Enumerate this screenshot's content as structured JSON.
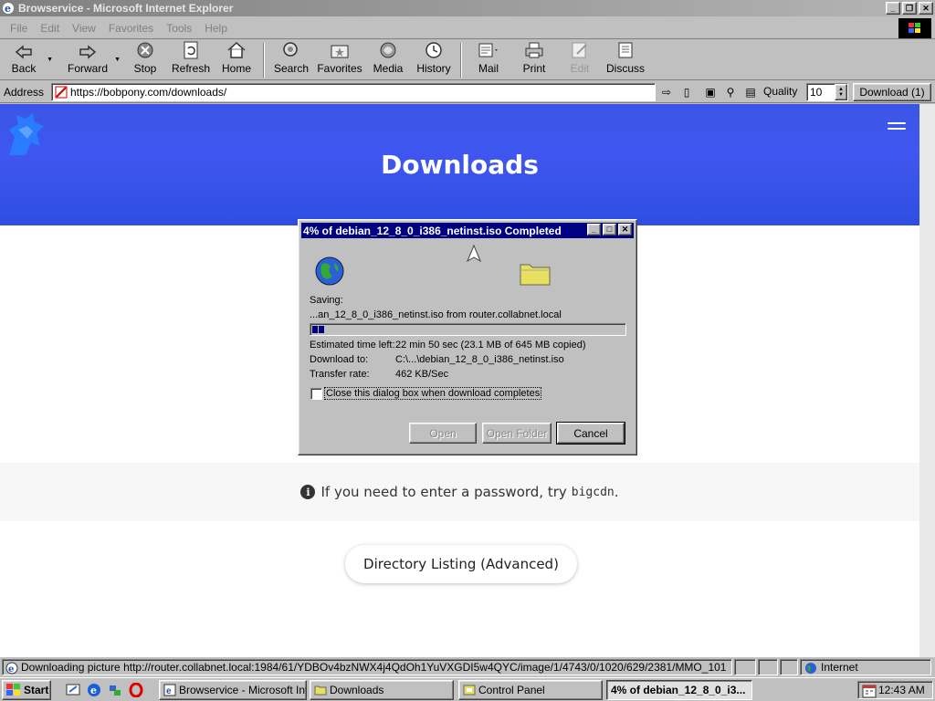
{
  "window": {
    "title": "Browservice - Microsoft Internet Explorer"
  },
  "menu": [
    "File",
    "Edit",
    "View",
    "Favorites",
    "Tools",
    "Help"
  ],
  "toolbar": {
    "back": "Back",
    "forward": "Forward",
    "stop": "Stop",
    "refresh": "Refresh",
    "home": "Home",
    "search": "Search",
    "favorites": "Favorites",
    "media": "Media",
    "history": "History",
    "mail": "Mail",
    "print": "Print",
    "edit": "Edit",
    "discuss": "Discuss"
  },
  "address": {
    "label": "Address",
    "url": "https://bobpony.com/downloads/",
    "quality_label": "Quality",
    "quality_value": "10",
    "download_button": "Download (1)"
  },
  "page": {
    "heading": "Downloads",
    "info_text": "If you need to enter a password, try",
    "info_code": "bigcdn",
    "info_suffix": ".",
    "directory_button": "Directory Listing (Advanced)",
    "hero_color": "#3a55e6"
  },
  "dialog": {
    "title": "4% of debian_12_8_0_i386_netinst.iso Completed",
    "saving_label": "Saving:",
    "saving_file": "...an_12_8_0_i386_netinst.iso from router.collabnet.local",
    "progress_percent": 4,
    "time_left_label": "Estimated time left:",
    "time_left_value": "22 min 50 sec (23.1 MB of 645 MB copied)",
    "download_to_label": "Download to:",
    "download_to_value": "C:\\...\\debian_12_8_0_i386_netinst.iso",
    "transfer_rate_label": "Transfer rate:",
    "transfer_rate_value": "462 KB/Sec",
    "close_checkbox_label": "Close this dialog box when download completes",
    "close_checkbox_checked": false,
    "open_button": "Open",
    "open_folder_button": "Open Folder",
    "cancel_button": "Cancel"
  },
  "statusbar": {
    "text": "Downloading picture http://router.collabnet.local:1984/61/YDBOv4bzNWX4j4QdOh1YuVXGDI5w4QYC/image/1/4743/0/1020/629/2381/MMO_101",
    "zone": "Internet"
  },
  "taskbar": {
    "start": "Start",
    "tasks": [
      "Browservice - Microsoft Int...",
      "Downloads",
      "Control Panel",
      "4% of debian_12_8_0_i3..."
    ],
    "clock": "12:43 AM"
  }
}
